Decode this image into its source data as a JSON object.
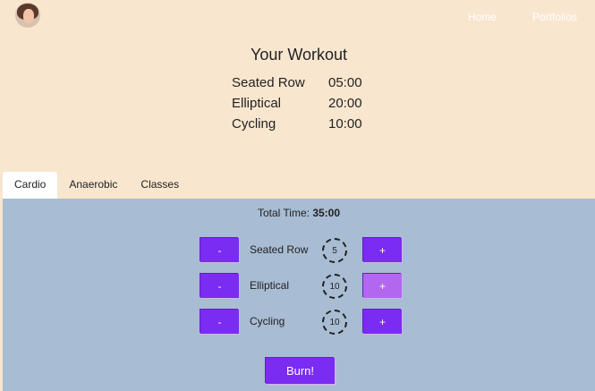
{
  "nav": {
    "home": "Home",
    "portfolios": "Portfolios"
  },
  "workout": {
    "title": "Your Workout",
    "items": [
      {
        "name": "Seated Row",
        "time": "05:00"
      },
      {
        "name": "Elliptical",
        "time": "20:00"
      },
      {
        "name": "Cycling",
        "time": "10:00"
      }
    ]
  },
  "tabs": [
    "Cardio",
    "Anaerobic",
    "Classes"
  ],
  "panel": {
    "total_label": "Total Time:",
    "total_value": "35:00",
    "exercises": [
      {
        "name": "Seated Row",
        "value": "5",
        "minus": "-",
        "plus": "+"
      },
      {
        "name": "Elliptical",
        "value": "10",
        "minus": "-",
        "plus": "+"
      },
      {
        "name": "Cycling",
        "value": "10",
        "minus": "-",
        "plus": "+"
      }
    ],
    "burn_label": "Burn!"
  },
  "colors": {
    "header_bg": "#f9e6cf",
    "panel_bg": "#a8bcd3",
    "button": "#7a2cf2",
    "button_hover": "#b267ef"
  },
  "icons": {
    "avatar": "profile-avatar"
  }
}
